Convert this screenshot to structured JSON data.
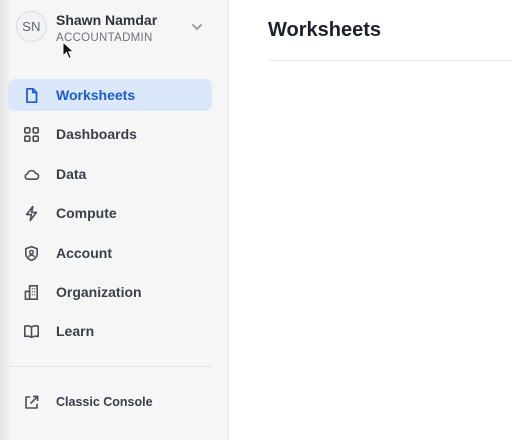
{
  "user": {
    "initials": "SN",
    "name": "Shawn Namdar",
    "role": "ACCOUNTADMIN",
    "menu_icon": "chevron-down-icon"
  },
  "nav": {
    "items": [
      {
        "label": "Worksheets",
        "icon": "document-icon",
        "active": true
      },
      {
        "label": "Dashboards",
        "icon": "grid-icon",
        "active": false
      },
      {
        "label": "Data",
        "icon": "cloud-icon",
        "active": false
      },
      {
        "label": "Compute",
        "icon": "lightning-icon",
        "active": false
      },
      {
        "label": "Account",
        "icon": "shield-user-icon",
        "active": false
      },
      {
        "label": "Organization",
        "icon": "building-icon",
        "active": false
      },
      {
        "label": "Learn",
        "icon": "book-icon",
        "active": false
      }
    ]
  },
  "footer": {
    "classic_console_label": "Classic Console",
    "classic_console_icon": "external-link-icon"
  },
  "main": {
    "title": "Worksheets"
  },
  "colors": {
    "accent": "#1a5bd1",
    "active_bg": "#dbe7fb",
    "sidebar_bg": "#f6f6f7"
  }
}
